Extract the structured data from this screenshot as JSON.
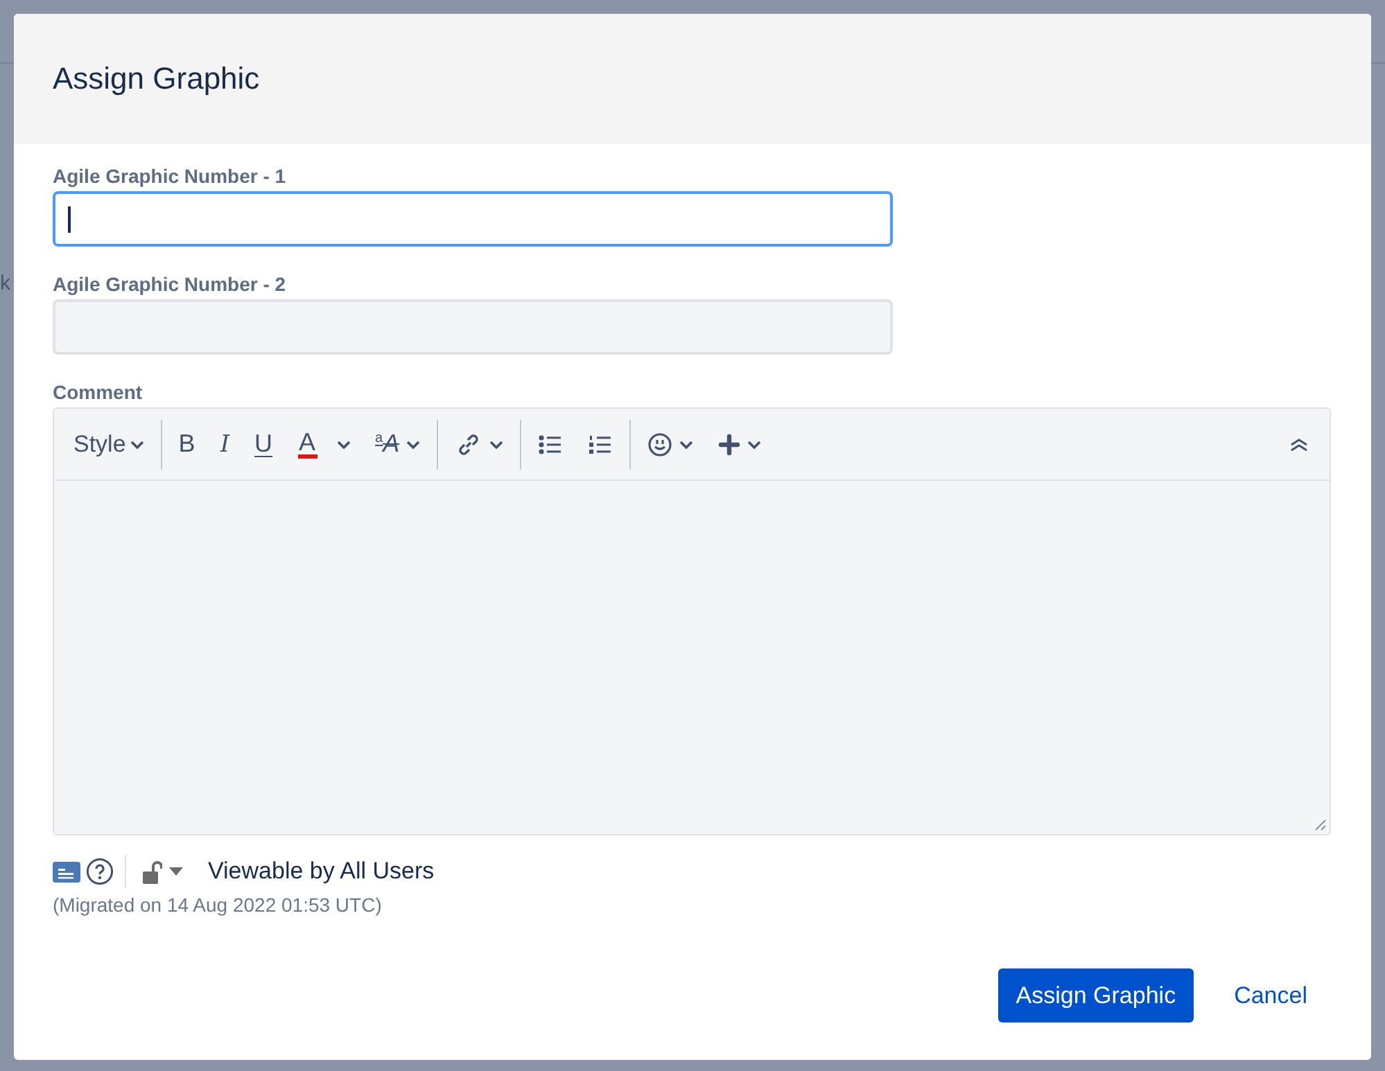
{
  "background": {
    "fragments": [
      {
        "kind": "body",
        "text": "k"
      }
    ]
  },
  "dialog": {
    "title": "Assign Graphic",
    "fields": [
      {
        "label": "Agile Graphic Number - 1",
        "focused": true
      },
      {
        "label": "Agile Graphic Number - 2",
        "focused": false
      }
    ],
    "comment": {
      "label": "Comment",
      "toolbar": [
        {
          "kind": "style",
          "label": "Style",
          "has_menu": true
        },
        {
          "kind": "separator"
        },
        {
          "kind": "bold",
          "label": "B",
          "has_menu": false
        },
        {
          "kind": "italic",
          "label": "I",
          "has_menu": false
        },
        {
          "kind": "underline",
          "label": "U",
          "has_menu": false
        },
        {
          "kind": "color",
          "label": "A",
          "has_menu": true
        },
        {
          "kind": "format",
          "label": "$^{a}$A",
          "has_menu": true
        },
        {
          "kind": "separator"
        },
        {
          "kind": "link",
          "has_menu": true
        },
        {
          "kind": "separator"
        },
        {
          "kind": "bullets",
          "has_menu": false
        },
        {
          "kind": "numbers",
          "has_menu": false
        },
        {
          "kind": "separator"
        },
        {
          "kind": "emoji",
          "has_menu": true
        },
        {
          "kind": "insert",
          "has_menu": true
        }
      ]
    },
    "restriction": "Viewable by All Users",
    "note": "(Migrated on 14 Aug 2022 01:53 UTC)",
    "buttons": [
      {
        "kind": "primary",
        "label": "Assign Graphic"
      },
      {
        "kind": "link",
        "label": "Cancel"
      }
    ]
  }
}
